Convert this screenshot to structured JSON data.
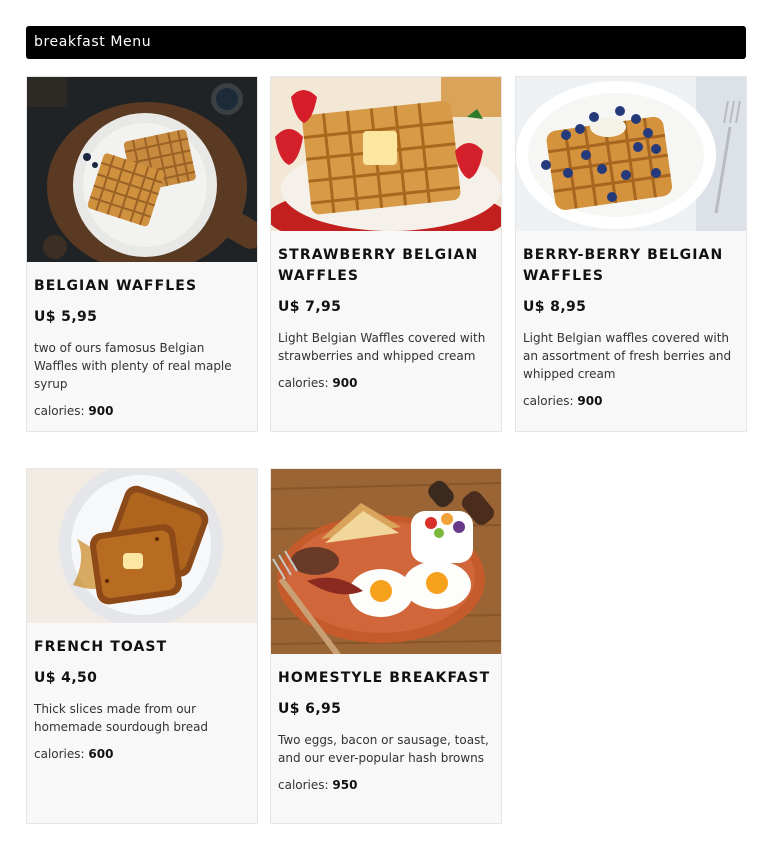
{
  "header": {
    "title": "breakfast Menu"
  },
  "calories_label": "calories:",
  "items": [
    {
      "name": "BELGIAN WAFFLES",
      "price": "U$ 5,95",
      "description": "two of ours famosus Belgian Waffles with plenty of real maple syrup",
      "calories": "900",
      "image_icon": "waffles-on-board-photo"
    },
    {
      "name": "STRAWBERRY BELGIAN WAFFLES",
      "price": "U$ 7,95",
      "description": "Light Belgian Waffles covered with strawberries and whipped cream",
      "calories": "900",
      "image_icon": "strawberry-waffle-photo"
    },
    {
      "name": "BERRY-BERRY BELGIAN WAFFLES",
      "price": "U$ 8,95",
      "description": "Light Belgian waffles covered with an assortment of fresh berries and whipped cream",
      "calories": "900",
      "image_icon": "berry-waffle-photo"
    },
    {
      "name": "FRENCH TOAST",
      "price": "U$ 4,50",
      "description": "Thick slices made from our homemade sourdough bread",
      "calories": "600",
      "image_icon": "french-toast-photo"
    },
    {
      "name": "HOMESTYLE BREAKFAST",
      "price": "U$ 6,95",
      "description": "Two eggs, bacon or sausage, toast, and our ever-popular hash browns",
      "calories": "950",
      "image_icon": "homestyle-breakfast-photo"
    }
  ]
}
